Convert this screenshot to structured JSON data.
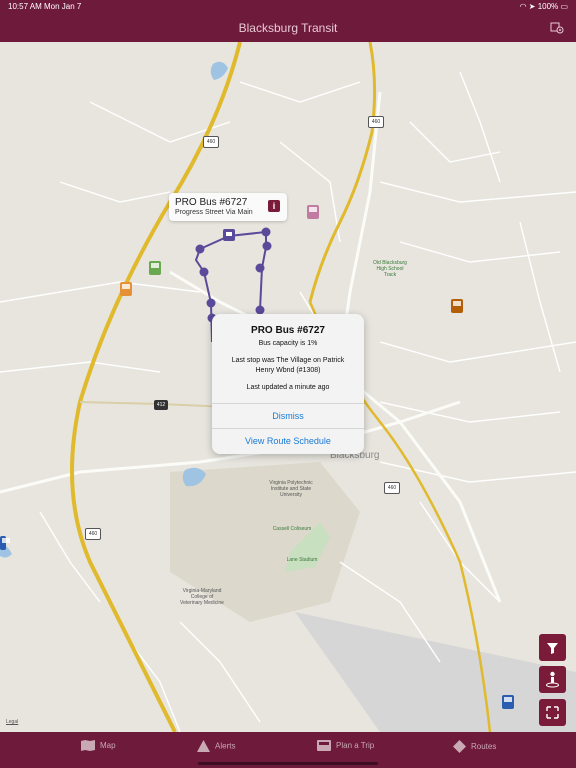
{
  "status_bar": {
    "time": "10:57 AM",
    "date": "Mon Jan 7",
    "battery": "100%"
  },
  "header": {
    "title": "Blacksburg Transit",
    "settings_icon": "settings-gear-icon"
  },
  "map": {
    "town_label": "Blacksburg",
    "legal_label": "Legal",
    "route_shields": [
      "460",
      "460",
      "460",
      "460",
      "412"
    ],
    "poi_labels": {
      "high_school": "Old Blacksburg High School Track",
      "vt": "Virginia Polytechnic Institute and State University",
      "cassell": "Cassell Coliseum",
      "lane": "Lane Stadium",
      "vetmed": "Virginia-Maryland College of Veterinary Medicine"
    },
    "route_color": "#5a4a9a",
    "bus_colors": [
      "#6aa84f",
      "#e69138",
      "#c27ba0",
      "#b45f06",
      "#2a5db0",
      "#2a5db0"
    ]
  },
  "callout": {
    "title": "PRO Bus #6727",
    "subtitle": "Progress Street Via Main",
    "info_label": "i"
  },
  "alert": {
    "title": "PRO Bus #6727",
    "capacity": "Bus capacity is 1%",
    "last_stop": "Last stop was The Village on Patrick Henry Wbnd (#1308)",
    "updated": "Last updated a minute ago",
    "dismiss": "Dismiss",
    "schedule": "View Route Schedule"
  },
  "map_controls": [
    "filter-icon",
    "locate-person-icon",
    "expand-icon"
  ],
  "tabs": [
    {
      "label": "Map",
      "icon": "map-icon"
    },
    {
      "label": "Alerts",
      "icon": "warning-icon"
    },
    {
      "label": "Plan a Trip",
      "icon": "trip-planner-icon"
    },
    {
      "label": "Routes",
      "icon": "routes-sign-icon"
    }
  ],
  "colors": {
    "bar": "#6e1a3a",
    "accent": "#7a1b3a",
    "link": "#1a7ad6"
  }
}
